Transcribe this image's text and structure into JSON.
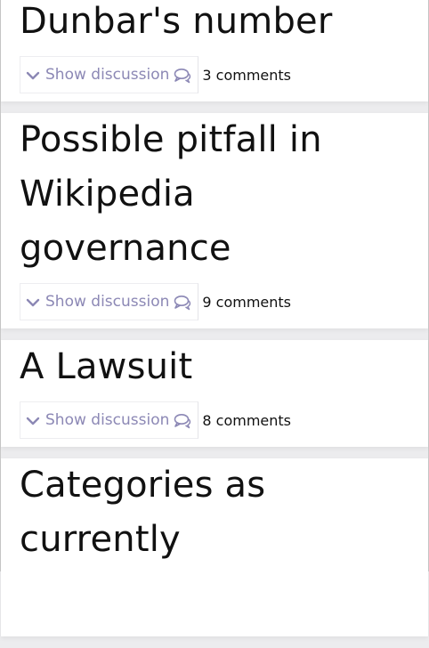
{
  "posts": [
    {
      "title": "Dunbar's number",
      "show_label": "Show discussion",
      "comments": "3 comments"
    },
    {
      "title": "Possible pitfall in Wikipedia governance",
      "show_label": "Show discussion",
      "comments": "9 comments"
    },
    {
      "title": "A Lawsuit",
      "show_label": "Show discussion",
      "comments": "8 comments"
    },
    {
      "title": "Categories as currently"
    }
  ],
  "colors": {
    "accent": "#8c88b5",
    "background": "#ececee",
    "card": "#ffffff"
  }
}
